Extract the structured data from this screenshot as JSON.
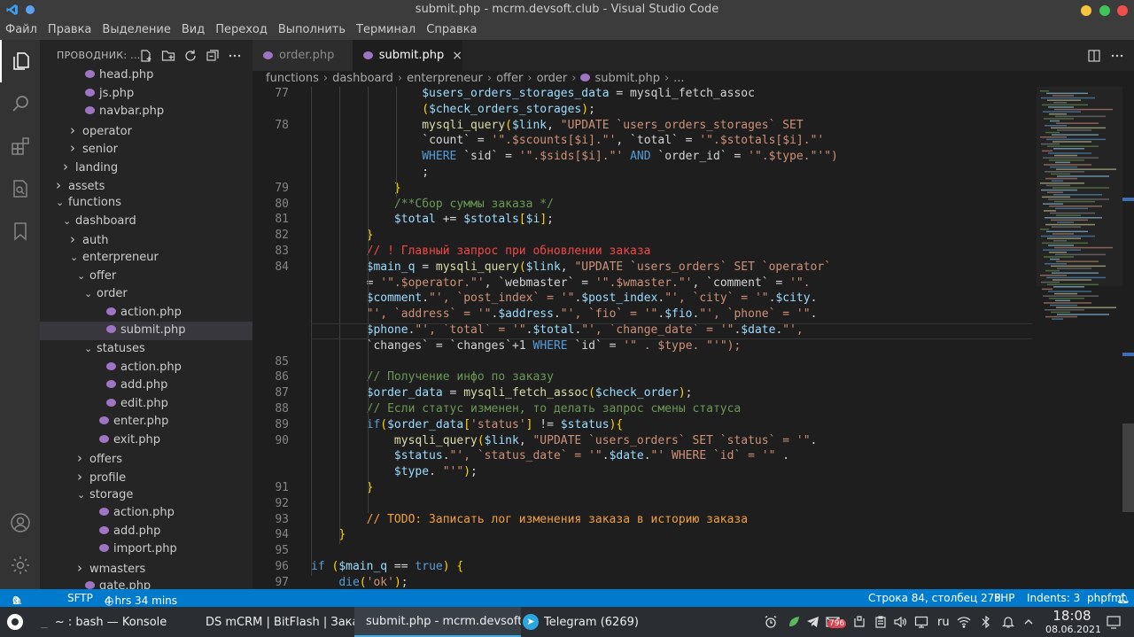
{
  "window": {
    "title": "submit.php - mcrm.devsoft.club - Visual Studio Code"
  },
  "menu": [
    "Файл",
    "Правка",
    "Выделение",
    "Вид",
    "Переход",
    "Выполнить",
    "Терминал",
    "Справка"
  ],
  "sidebar": {
    "title": "ПРОВОДНИК: ...",
    "tree": [
      {
        "label": "head.php",
        "indent": 2,
        "type": "file"
      },
      {
        "label": "js.php",
        "indent": 2,
        "type": "file"
      },
      {
        "label": "navbar.php",
        "indent": 2,
        "type": "file"
      },
      {
        "label": "operator",
        "indent": 2,
        "type": "folder",
        "open": false
      },
      {
        "label": "senior",
        "indent": 2,
        "type": "folder",
        "open": false
      },
      {
        "label": "landing",
        "indent": 1,
        "type": "folder",
        "open": false
      },
      {
        "label": "assets",
        "indent": 0,
        "type": "folder",
        "open": false
      },
      {
        "label": "functions",
        "indent": 0,
        "type": "folder",
        "open": true
      },
      {
        "label": "dashboard",
        "indent": 1,
        "type": "folder",
        "open": true
      },
      {
        "label": "auth",
        "indent": 2,
        "type": "folder",
        "open": false
      },
      {
        "label": "enterpreneur",
        "indent": 2,
        "type": "folder",
        "open": true
      },
      {
        "label": "offer",
        "indent": 3,
        "type": "folder",
        "open": true
      },
      {
        "label": "order",
        "indent": 4,
        "type": "folder",
        "open": true
      },
      {
        "label": "action.php",
        "indent": 5,
        "type": "file"
      },
      {
        "label": "submit.php",
        "indent": 5,
        "type": "file",
        "selected": true
      },
      {
        "label": "statuses",
        "indent": 4,
        "type": "folder",
        "open": true
      },
      {
        "label": "action.php",
        "indent": 5,
        "type": "file"
      },
      {
        "label": "add.php",
        "indent": 5,
        "type": "file"
      },
      {
        "label": "edit.php",
        "indent": 5,
        "type": "file"
      },
      {
        "label": "enter.php",
        "indent": 4,
        "type": "file"
      },
      {
        "label": "exit.php",
        "indent": 4,
        "type": "file"
      },
      {
        "label": "offers",
        "indent": 3,
        "type": "folder",
        "open": false
      },
      {
        "label": "profile",
        "indent": 3,
        "type": "folder",
        "open": false
      },
      {
        "label": "storage",
        "indent": 3,
        "type": "folder",
        "open": true
      },
      {
        "label": "action.php",
        "indent": 4,
        "type": "file"
      },
      {
        "label": "add.php",
        "indent": 4,
        "type": "file"
      },
      {
        "label": "import.php",
        "indent": 4,
        "type": "file"
      },
      {
        "label": "wmasters",
        "indent": 3,
        "type": "folder",
        "open": false
      },
      {
        "label": "gate.php",
        "indent": 2,
        "type": "file"
      }
    ]
  },
  "tabs": [
    {
      "label": "order.php",
      "active": false
    },
    {
      "label": "submit.php",
      "active": true,
      "close": "×"
    }
  ],
  "breadcrumb": [
    "functions",
    "dashboard",
    "enterpreneur",
    "offer",
    "order",
    "submit.php",
    "..."
  ],
  "code": [
    {
      "n": "77",
      "t": "                $users_orders_storages_data = mysqli_fetch_assoc"
    },
    {
      "n": "",
      "t": "                ($check_orders_storages);"
    },
    {
      "n": "78",
      "t": "                mysqli_query($link, \"UPDATE `users_orders_storages` SET"
    },
    {
      "n": "",
      "t": "                `count` = '\".$scounts[$i].\"', `total` = '\".$stotals[$i].\"'"
    },
    {
      "n": "",
      "t": "                WHERE `sid` = '\".$sids[$i].\"' AND `order_id` = '\".$type.\"'\")"
    },
    {
      "n": "",
      "t": "                ;"
    },
    {
      "n": "79",
      "t": "            }"
    },
    {
      "n": "80",
      "t": "            /**Сбор суммы заказа */"
    },
    {
      "n": "81",
      "t": "            $total += $stotals[$i];"
    },
    {
      "n": "82",
      "t": "        }"
    },
    {
      "n": "83",
      "t": "        // ! Главный запрос при обновлении заказа"
    },
    {
      "n": "84",
      "t": "        $main_q = mysqli_query($link, \"UPDATE `users_orders` SET `operator`"
    },
    {
      "n": "",
      "t": "        = '\".$operator.\"', `webmaster` = '\".$wmaster.\"', `comment` = '\"."
    },
    {
      "n": "",
      "t": "        $comment.\"', `post_index` = '\".$post_index.\"', `city` = '\".$city."
    },
    {
      "n": "",
      "t": "        \"', `address` = '\".$address.\"', `fio` = '\".$fio.\"', `phone` = '\"."
    },
    {
      "n": "",
      "t": "        $phone.\"', `total` = '\".$total.\"', `change_date` = '\".$date.\"',"
    },
    {
      "n": "",
      "t": "        `changes` = `changes`+1 WHERE `id` = '\" . $type. \"'\");"
    },
    {
      "n": "85",
      "t": ""
    },
    {
      "n": "86",
      "t": "        // Получение инфо по заказу"
    },
    {
      "n": "87",
      "t": "        $order_data = mysqli_fetch_assoc($check_order);"
    },
    {
      "n": "88",
      "t": "        // Если статус изменен, то делать запрос смены статуса"
    },
    {
      "n": "89",
      "t": "        if($order_data['status'] != $status){"
    },
    {
      "n": "90",
      "t": "            mysqli_query($link, \"UPDATE `users_orders` SET `status` = '\"."
    },
    {
      "n": "",
      "t": "            $status.\"', `status_date` = '\".$date.\"' WHERE `id` = '\" ."
    },
    {
      "n": "",
      "t": "            $type. \"'\");"
    },
    {
      "n": "91",
      "t": "        }"
    },
    {
      "n": "92",
      "t": ""
    },
    {
      "n": "93",
      "t": "        // TODO: Записать лог изменения заказа в историю заказа"
    },
    {
      "n": "94",
      "t": "    }"
    },
    {
      "n": "95",
      "t": ""
    },
    {
      "n": "96",
      "t": "if ($main_q == true) {"
    },
    {
      "n": "97",
      "t": "    die('ok');"
    }
  ],
  "status": {
    "errors": "0",
    "warnings": "0",
    "sftp": "SFTP",
    "time": "4 hrs 34 mins",
    "position": "Строка 84, столбец 275",
    "lang": "PHP",
    "indents": "Indents: 3",
    "fmt": "phpfmt"
  },
  "taskbar": {
    "items": [
      {
        "label": "~ : bash — Konsole"
      },
      {
        "label": "DS mCRM | BitFlash | Зака..."
      },
      {
        "label": "submit.php - mcrm.devsoft..."
      },
      {
        "label": "Telegram (6269)"
      }
    ],
    "badge": "796",
    "lang": "ru",
    "time": "18:08",
    "date": "08.06.2021"
  }
}
